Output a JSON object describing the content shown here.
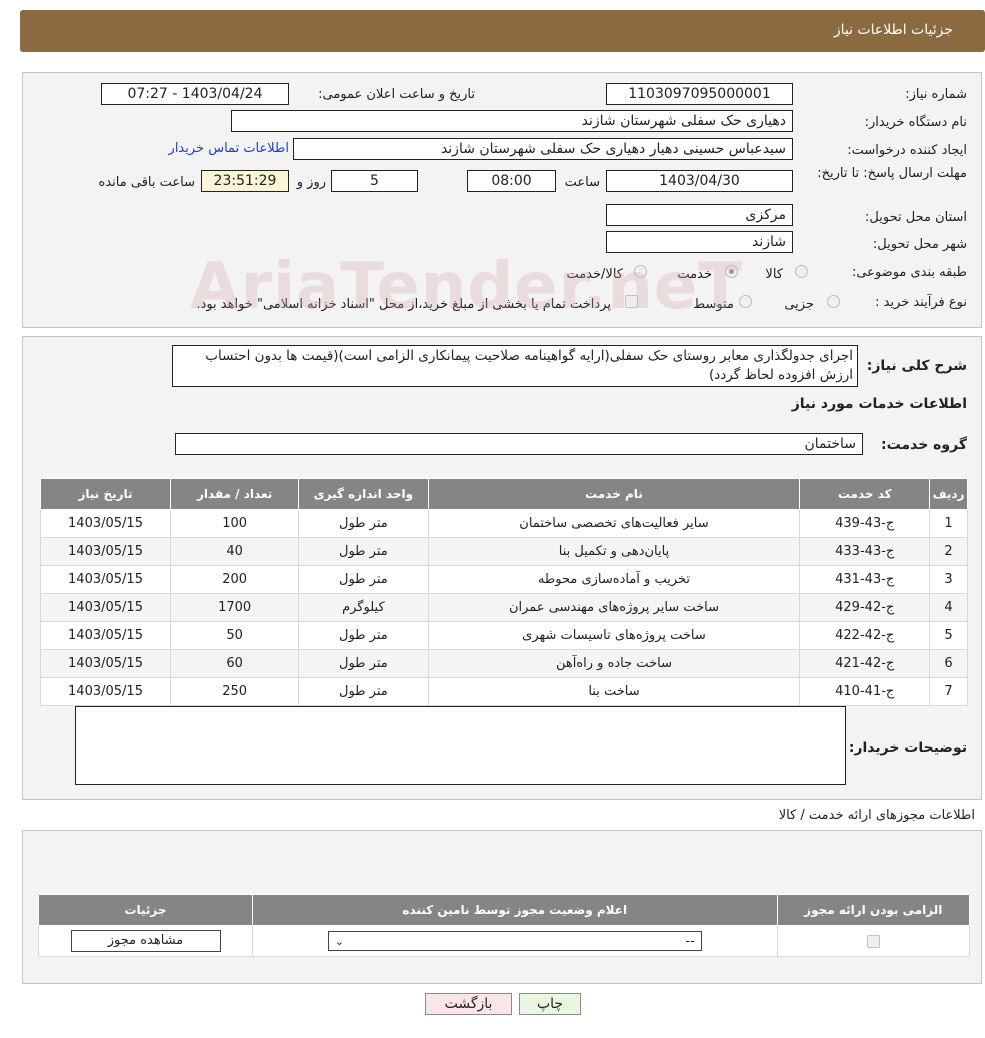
{
  "header": {
    "title": "جزئیات اطلاعات نیاز"
  },
  "form": {
    "need_number_label": "شماره نیاز:",
    "need_number": "1103097095000001",
    "announce_label": "تاریخ و ساعت اعلان عمومی:",
    "announce_value": "1403/04/24 - 07:27",
    "buyer_org_label": "نام دستگاه خریدار:",
    "buyer_org": "دهیاری حک سفلی شهرستان شازند",
    "creator_label": "ایجاد کننده درخواست:",
    "creator": "سیدعباس حسینی دهیار دهیاری حک سفلی شهرستان شازند",
    "contact_link": "اطلاعات تماس خریدار",
    "deadline_label": "مهلت ارسال پاسخ: تا تاریخ:",
    "deadline_date": "1403/04/30",
    "time_label": "ساعت",
    "deadline_time": "08:00",
    "days_value": "5",
    "days_label": "روز و",
    "remaining_value": "23:51:29",
    "remaining_label": "ساعت باقی مانده",
    "province_label": "استان محل تحویل:",
    "province": "مرکزی",
    "city_label": "شهر محل تحویل:",
    "city": "شازند",
    "category_label": "طبقه بندی موضوعی:",
    "category_options": [
      "کالا",
      "خدمت",
      "کالا/خدمت"
    ],
    "category_selected": "خدمت",
    "process_label": "نوع فرآیند خرید :",
    "process_options": [
      "جزیی",
      "متوسط"
    ],
    "payment_note": "پرداخت تمام یا بخشی از مبلغ خرید،از محل \"اسناد خزانه اسلامی\" خواهد بود."
  },
  "description": {
    "label": "شرح کلی نیاز:",
    "text": "اجرای جدولگذاری معابر روستای حک سفلی(ارایه گواهینامه صلاحیت پیمانکاری الزامی است)(قیمت ها بدون احتساب ارزش افزوده لحاظ گردد)"
  },
  "services": {
    "section_title": "اطلاعات خدمات مورد نیاز",
    "group_label": "گروه خدمت:",
    "group_value": "ساختمان",
    "columns": [
      "ردیف",
      "کد خدمت",
      "نام خدمت",
      "واحد اندازه گیری",
      "تعداد / مقدار",
      "تاریخ نیاز"
    ],
    "rows": [
      [
        "1",
        "ج-43-439",
        "سایر فعالیت‌های تخصصی ساختمان",
        "متر طول",
        "100",
        "1403/05/15"
      ],
      [
        "2",
        "ج-43-433",
        "پایان‌دهی و تکمیل بنا",
        "متر طول",
        "40",
        "1403/05/15"
      ],
      [
        "3",
        "ج-43-431",
        "تخریب و آماده‌سازی محوطه",
        "متر طول",
        "200",
        "1403/05/15"
      ],
      [
        "4",
        "ج-42-429",
        "ساخت سایر پروژه‌های مهندسی عمران",
        "کیلوگرم",
        "1700",
        "1403/05/15"
      ],
      [
        "5",
        "ج-42-422",
        "ساخت پروژه‌های تاسیسات شهری",
        "متر طول",
        "50",
        "1403/05/15"
      ],
      [
        "6",
        "ج-42-421",
        "ساخت جاده و راه‌آهن",
        "متر طول",
        "60",
        "1403/05/15"
      ],
      [
        "7",
        "ج-41-410",
        "ساخت بنا",
        "متر طول",
        "250",
        "1403/05/15"
      ]
    ]
  },
  "buyer_notes": {
    "label": "توضیحات خریدار:",
    "text": ""
  },
  "licenses": {
    "title": "اطلاعات مجوزهای ارائه خدمت / کالا",
    "columns": [
      "الزامی بودن ارائه مجوز",
      "اعلام وضعیت مجوز توسط نامین کننده",
      "جزئیات"
    ],
    "select_value": "--",
    "view_button": "مشاهده مجوز"
  },
  "buttons": {
    "print": "چاپ",
    "back": "بازگشت"
  },
  "watermark": "AriaTender.neT"
}
